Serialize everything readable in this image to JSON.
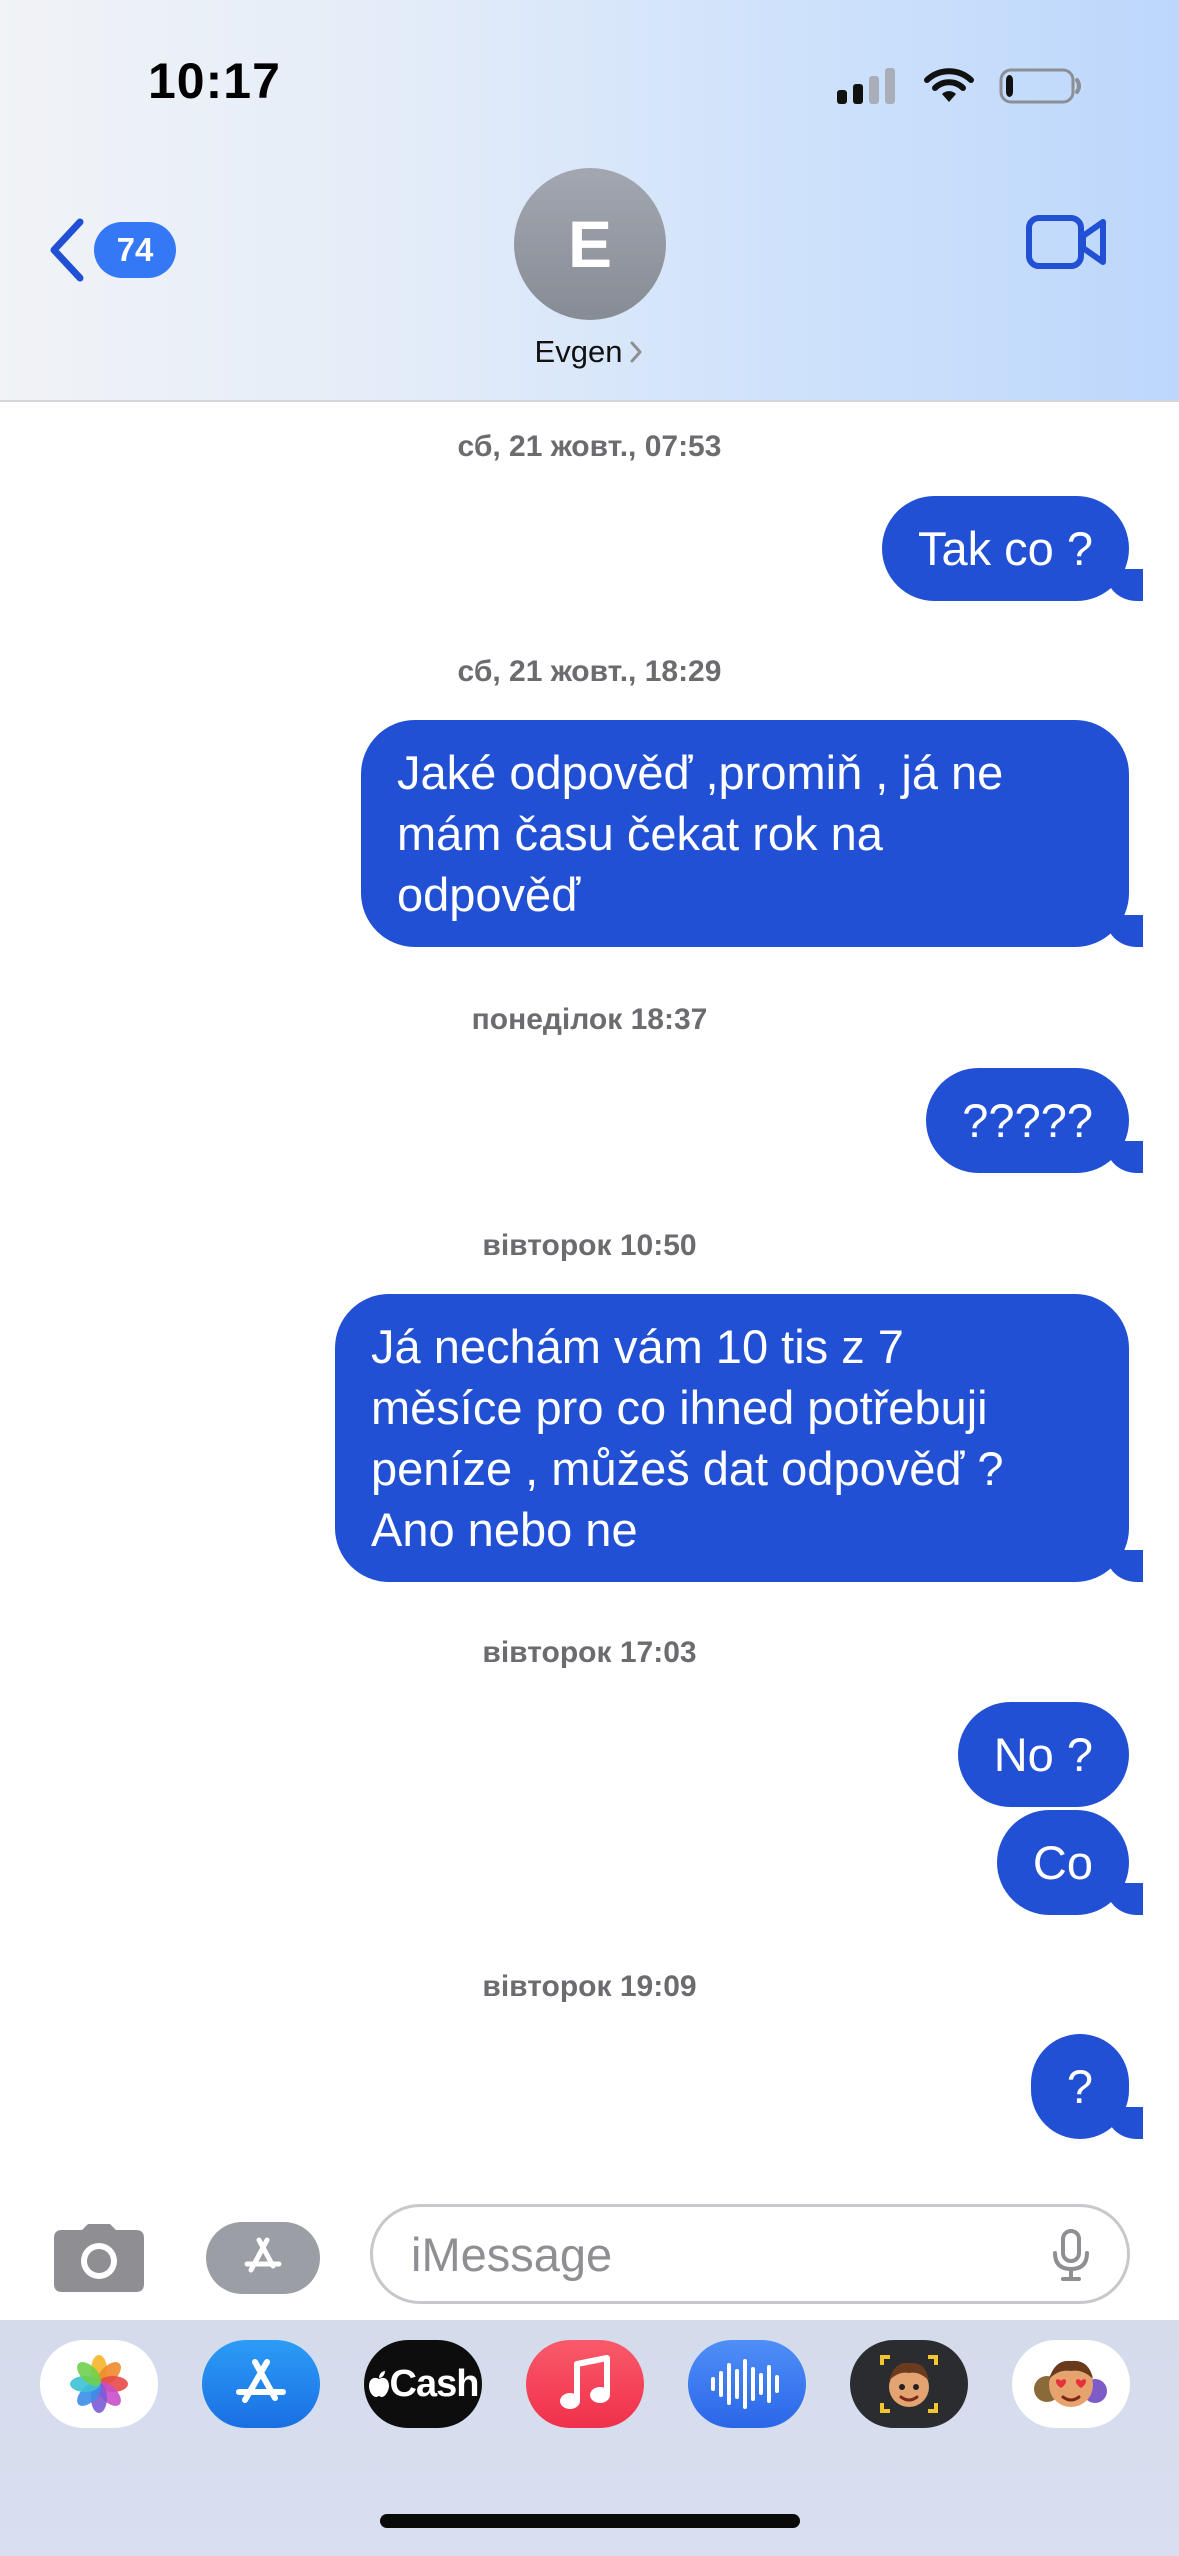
{
  "status_bar": {
    "time": "10:17",
    "battery_level": 0.12
  },
  "header": {
    "back_badge": "74",
    "avatar_initial": "E",
    "contact_name": "Evgen"
  },
  "thread": {
    "ts1": "сб, 21 жовт., 07:53",
    "msg1": "Tak co ?",
    "ts2": "сб, 21 жовт., 18:29",
    "msg2": {
      "line1": "Jaké odpověď ,promiň , já ne",
      "line2": "mám času čekat rok na",
      "line3": "odpověď"
    },
    "ts3": "понеділок 18:37",
    "msg3": "?????",
    "ts4": "вівторок 10:50",
    "msg4": {
      "line1": "Já nechám vám 10 tis z 7",
      "line2": "měsíce pro co ihned potřebuji",
      "line3": "peníze , můžeš dat odpověď ?",
      "line4": "Ano nebo ne"
    },
    "ts5": "вівторок 17:03",
    "msg5": "No ?",
    "msg6": "Co",
    "ts6": "вівторок 19:09",
    "msg7": "?"
  },
  "composer": {
    "placeholder": "iMessage"
  },
  "dock": {
    "apps": [
      "photos-app",
      "app-store-app",
      "apple-cash-app",
      "music-app",
      "audio-message-app",
      "memoji-app",
      "animoji-stickers-app"
    ],
    "cash_label": "Cash"
  },
  "colors": {
    "bubble": "#2150d5",
    "accent": "#3478f6"
  }
}
